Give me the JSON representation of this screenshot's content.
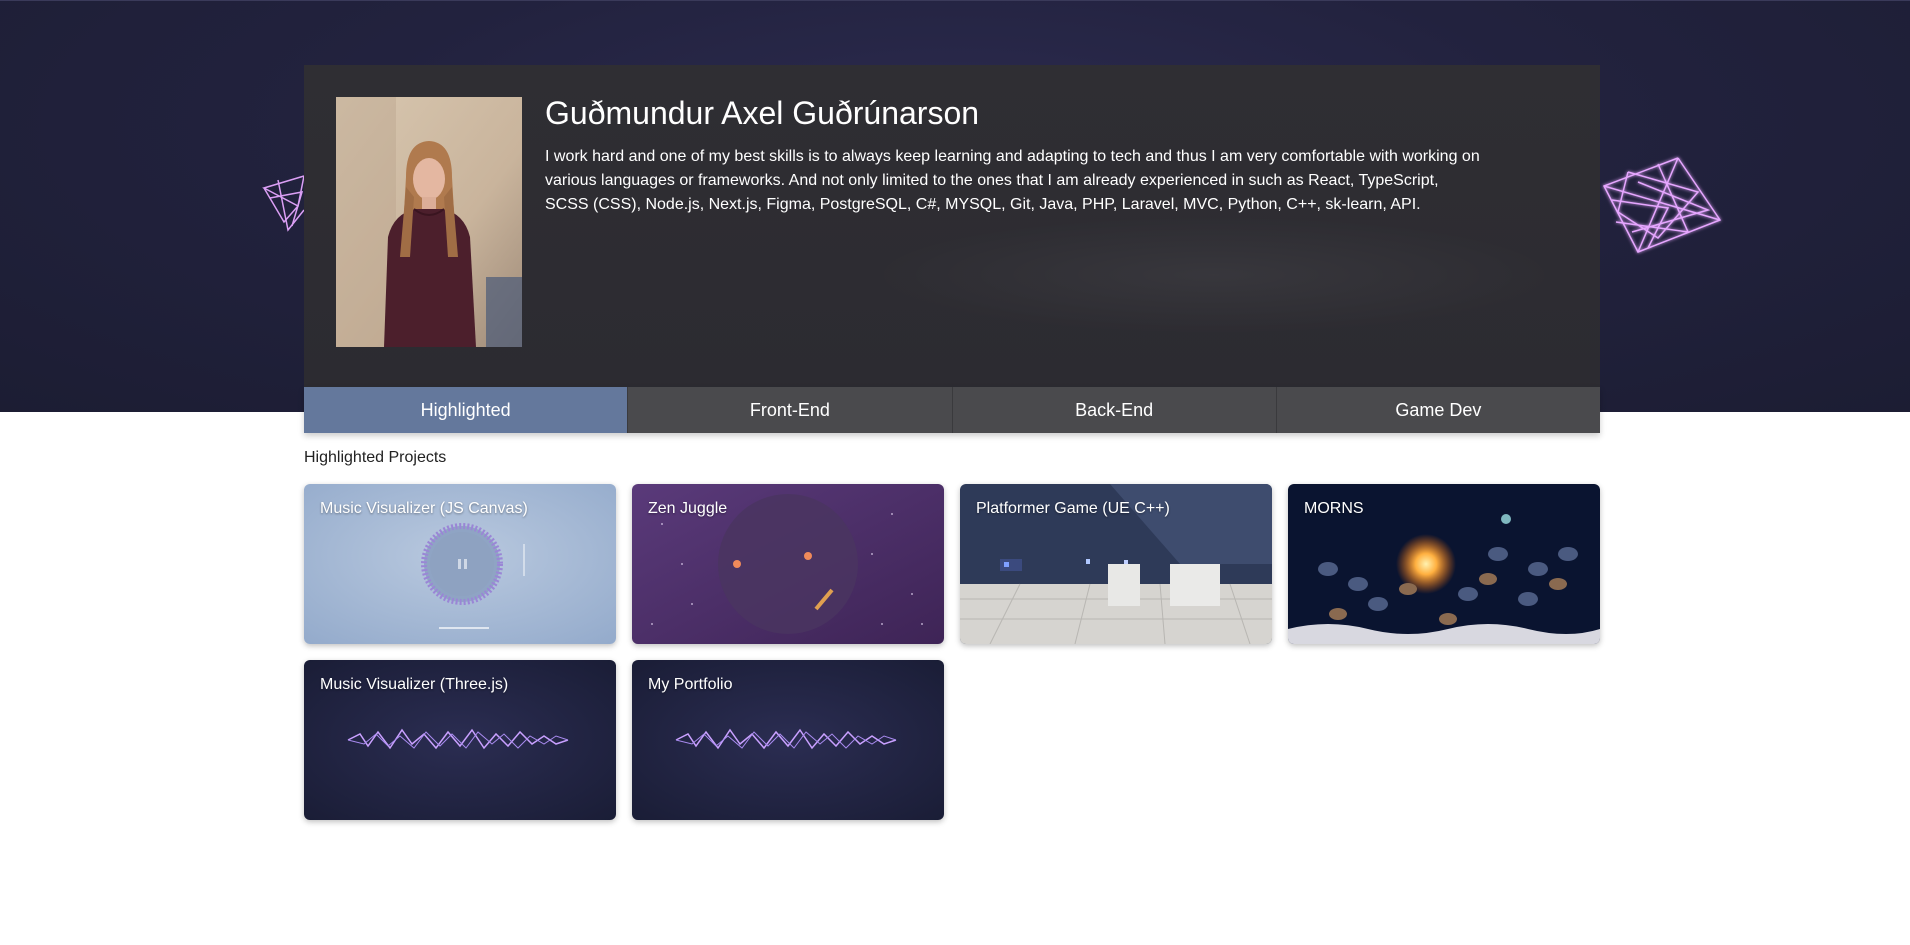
{
  "profile": {
    "name": "Guðmundur Axel Guðrúnarson",
    "bio": "I work hard and one of my best skills is to always keep learning and adapting to tech and thus I am very comfortable with working on various languages or frameworks. And not only limited to the ones that I am already experienced in such as React, TypeScript, SCSS (CSS), Node.js, Next.js, Figma, PostgreSQL, C#, MYSQL, Git, Java, PHP, Laravel, MVC, Python, C++, sk-learn, API."
  },
  "tabs": [
    {
      "label": "Highlighted",
      "active": true
    },
    {
      "label": "Front-End",
      "active": false
    },
    {
      "label": "Back-End",
      "active": false
    },
    {
      "label": "Game Dev",
      "active": false
    }
  ],
  "section": {
    "title": "Highlighted Projects"
  },
  "projects": [
    {
      "title": "Music Visualizer (JS Canvas)"
    },
    {
      "title": "Zen Juggle"
    },
    {
      "title": "Platformer Game (UE C++)"
    },
    {
      "title": "MORNS"
    },
    {
      "title": "Music Visualizer (Three.js)"
    },
    {
      "title": "My Portfolio"
    }
  ],
  "colors": {
    "hero_bg": "#22223e",
    "card_bg": "#2e2d32",
    "tab_bg": "#4a4a4d",
    "tab_active": "#64789c",
    "accent_purple": "#c98bff"
  }
}
